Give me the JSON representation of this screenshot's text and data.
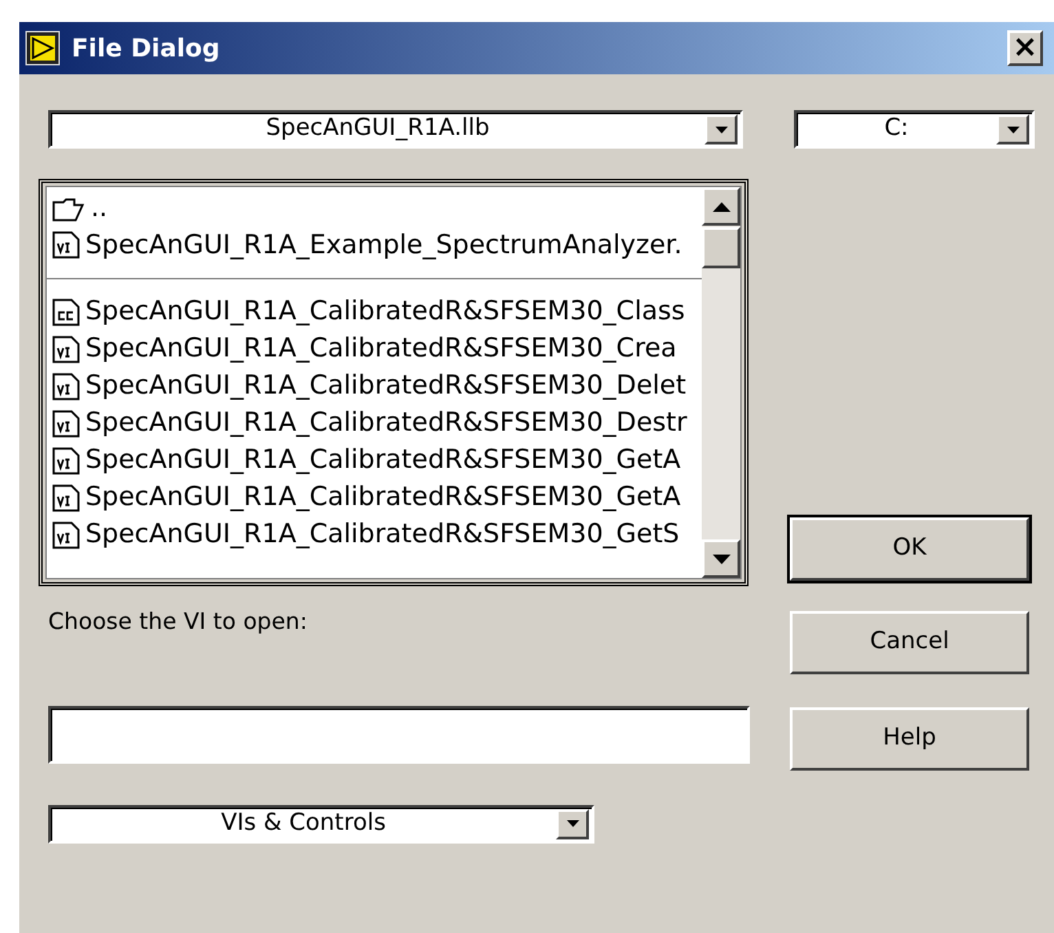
{
  "window": {
    "title": "File Dialog",
    "close": "×"
  },
  "path_dropdown": {
    "value": "SpecAnGUI_R1A.llb"
  },
  "drive_dropdown": {
    "value": "C:"
  },
  "files": [
    {
      "kind": "folder",
      "label": "..",
      "separator_after": false
    },
    {
      "kind": "vi",
      "label": "SpecAnGUI_R1A_Example_SpectrumAnalyzer.",
      "separator_after": true
    },
    {
      "kind": "ctl",
      "label": "SpecAnGUI_R1A_CalibratedR&SFSEM30_Class",
      "separator_after": false
    },
    {
      "kind": "vi",
      "label": "SpecAnGUI_R1A_CalibratedR&SFSEM30_Crea",
      "separator_after": false
    },
    {
      "kind": "vi",
      "label": "SpecAnGUI_R1A_CalibratedR&SFSEM30_Delet",
      "separator_after": false
    },
    {
      "kind": "vi",
      "label": "SpecAnGUI_R1A_CalibratedR&SFSEM30_Destr",
      "separator_after": false
    },
    {
      "kind": "vi",
      "label": "SpecAnGUI_R1A_CalibratedR&SFSEM30_GetA",
      "separator_after": false
    },
    {
      "kind": "vi",
      "label": "SpecAnGUI_R1A_CalibratedR&SFSEM30_GetA",
      "separator_after": false
    },
    {
      "kind": "vi",
      "label": "SpecAnGUI_R1A_CalibratedR&SFSEM30_GetS",
      "separator_after": false
    }
  ],
  "prompt": "Choose the VI to open:",
  "filter_dropdown": {
    "value": "VIs & Controls"
  },
  "buttons": [
    {
      "label": "OK",
      "default": true
    },
    {
      "label": "Cancel",
      "default": false
    },
    {
      "label": "Help",
      "default": false
    }
  ]
}
